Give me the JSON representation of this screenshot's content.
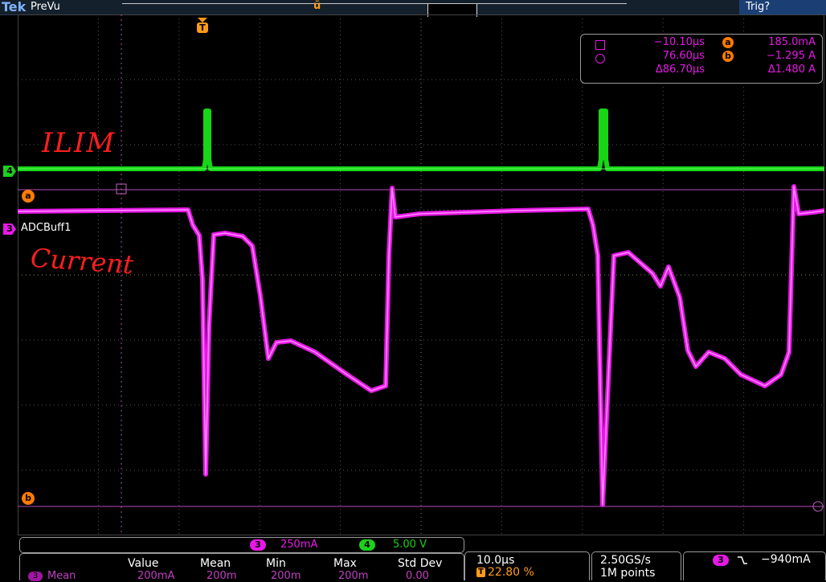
{
  "header": {
    "logo": "Tek",
    "acq_state": "PreVu",
    "record_center_marker": "ŭ",
    "trigger_status": "Trig?"
  },
  "channels": {
    "ch4": {
      "number": "4",
      "color": "#1bd11b"
    },
    "ch3": {
      "number": "3",
      "color": "#e619e6",
      "name": "ADCBuff1"
    }
  },
  "trigger_marker": "T",
  "cursors": {
    "a_label": "a",
    "b_label": "b",
    "readout": {
      "time_a": "−10.10µs",
      "time_b": "76.60µs",
      "time_delta": "Δ86.70µs",
      "value_a": "185.0mA",
      "value_b": "−1.295 A",
      "value_delta": "Δ1.480 A"
    }
  },
  "annotations": {
    "ilim": "ILIM",
    "current": "Current"
  },
  "vertical_scale": {
    "ch3_badge": "3",
    "ch3_scale": "250mA",
    "ch4_badge": "4",
    "ch4_scale": "5.00 V"
  },
  "measurements": {
    "headers": [
      "Value",
      "Mean",
      "Min",
      "Max",
      "Std Dev"
    ],
    "row_badge": "3",
    "row_label": "Mean",
    "row_values": [
      "200mA",
      "200m",
      "200m",
      "200m",
      "0.00"
    ]
  },
  "timebase": {
    "scale": "10.0µs",
    "trigger_position": "22.80 %"
  },
  "sampling": {
    "rate": "2.50GS/s",
    "record_length": "1M points"
  },
  "trigger_readout": {
    "source": "3",
    "slope": "falling-edge-icon",
    "level": "−940mA"
  }
}
